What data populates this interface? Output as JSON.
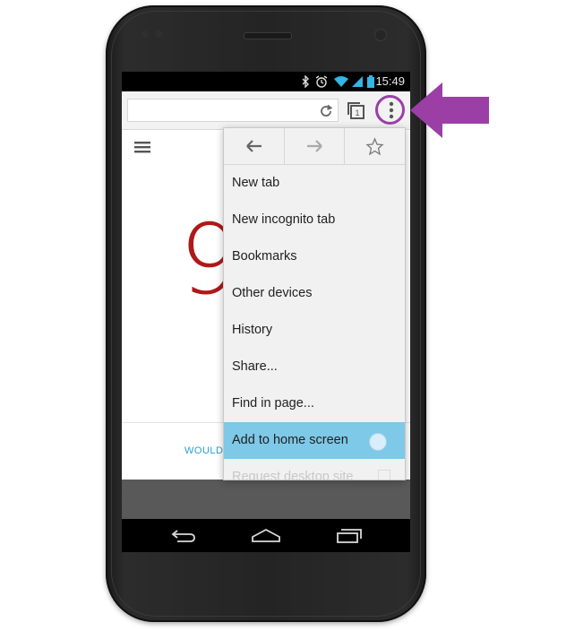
{
  "status_bar": {
    "time": "15:49",
    "icons": [
      "bluetooth-icon",
      "alarm-icon",
      "wifi-icon",
      "signal-icon",
      "battery-icon"
    ]
  },
  "toolbar": {
    "url": "",
    "icons": [
      "reload-icon",
      "tabs-icon",
      "overflow-menu-icon"
    ],
    "tab_count": "1"
  },
  "page": {
    "logo_glyph": "9",
    "bottom_text": "WOULD"
  },
  "menu": {
    "nav_icons": [
      "back-arrow-icon",
      "forward-arrow-icon",
      "star-icon"
    ],
    "items": [
      {
        "label": "New tab"
      },
      {
        "label": "New incognito tab"
      },
      {
        "label": "Bookmarks"
      },
      {
        "label": "Other devices"
      },
      {
        "label": "History"
      },
      {
        "label": "Share..."
      },
      {
        "label": "Find in page..."
      },
      {
        "label": "Add to home screen",
        "highlighted": true
      },
      {
        "label": "Request desktop site",
        "faded": true
      }
    ]
  },
  "annotation": {
    "ring_color": "#9b3fa6",
    "arrow_color": "#9b3fa6"
  },
  "system_nav": [
    "back-nav-icon",
    "home-nav-icon",
    "recents-nav-icon"
  ]
}
